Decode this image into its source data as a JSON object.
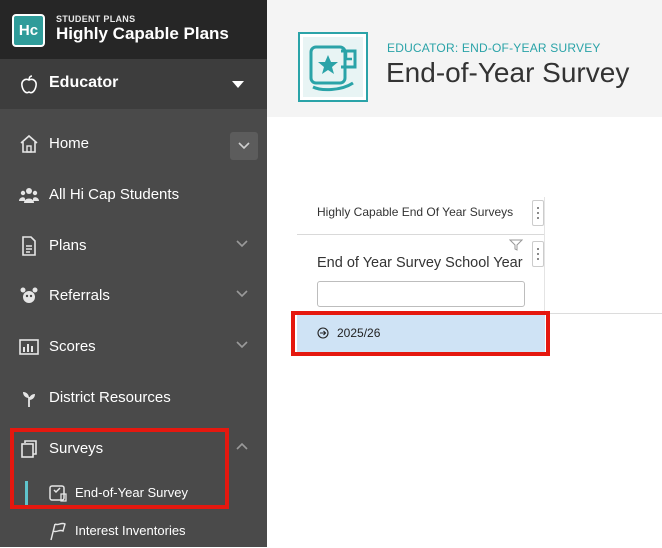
{
  "brand": {
    "logo_text": "Hc",
    "subtitle": "STUDENT PLANS",
    "title": "Highly Capable Plans"
  },
  "role": {
    "label": "Educator",
    "icon": "apple-icon"
  },
  "nav": {
    "home": "Home",
    "all_students": "All Hi Cap Students",
    "plans": "Plans",
    "referrals": "Referrals",
    "scores": "Scores",
    "district_resources": "District Resources",
    "surveys": "Surveys"
  },
  "subnav": {
    "end_of_year": "End-of-Year Survey",
    "interest_inventories": "Interest Inventories"
  },
  "header": {
    "eyebrow": "EDUCATOR: END-OF-YEAR SURVEY",
    "title": "End-of-Year Survey"
  },
  "grid": {
    "panel_title": "Highly Capable End Of Year Surveys",
    "column_header": "End of Year Survey School Year",
    "filter_value": "",
    "rows": [
      {
        "label": "2025/26"
      }
    ]
  },
  "colors": {
    "sidebar": "#4a4a4a",
    "brand_bar": "#262626",
    "accent_teal": "#2aa3a8",
    "highlight_red": "#e5180f",
    "selected_row": "#cfe3f5"
  }
}
